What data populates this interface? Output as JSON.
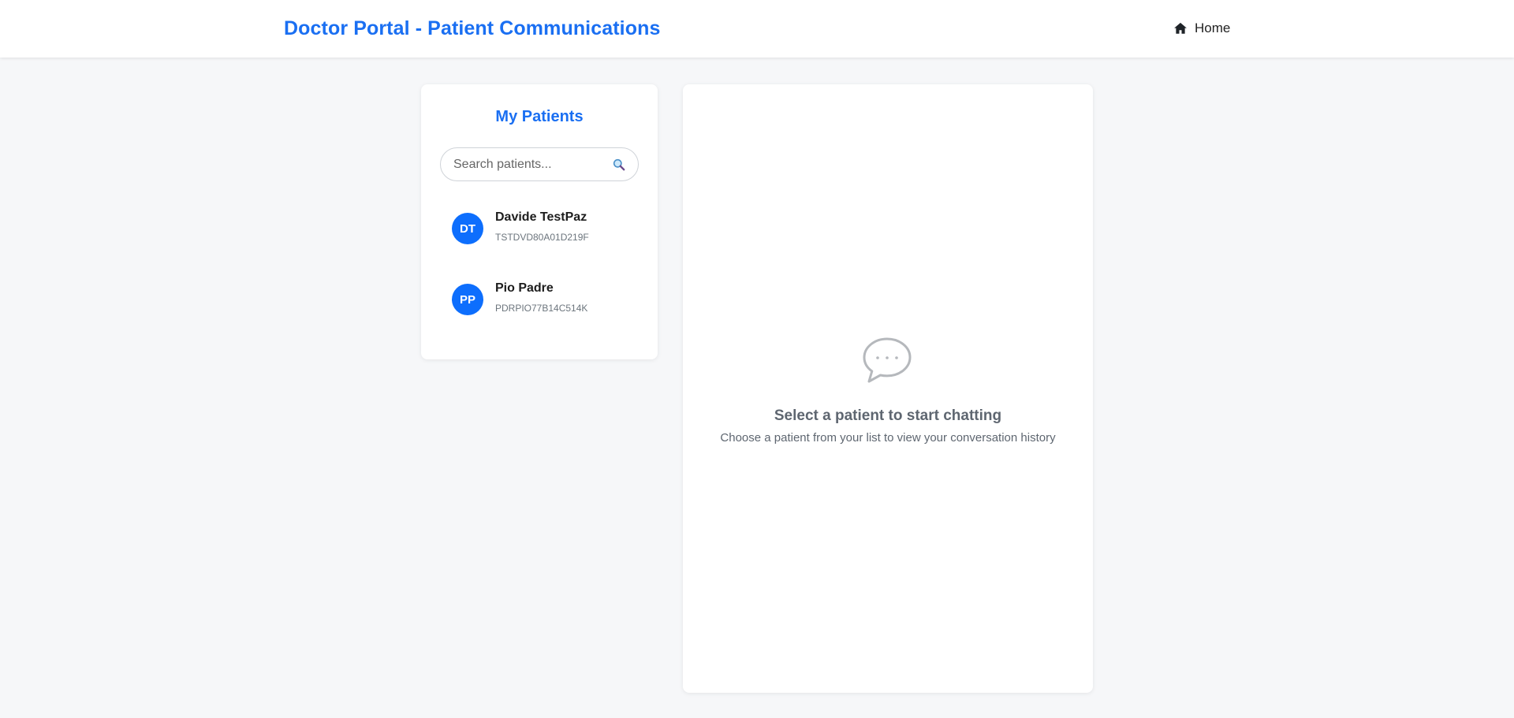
{
  "header": {
    "title": "Doctor Portal - Patient Communications",
    "home_label": "Home"
  },
  "sidebar": {
    "title": "My Patients",
    "search_placeholder": "Search patients...",
    "patients": [
      {
        "initials": "DT",
        "name": "Davide TestPaz",
        "code": "TSTDVD80A01D219F"
      },
      {
        "initials": "PP",
        "name": "Pio Padre",
        "code": "PDRPIO77B14C514K"
      }
    ]
  },
  "chat": {
    "empty_title": "Select a patient to start chatting",
    "empty_subtitle": "Choose a patient from your list to view your conversation history"
  },
  "colors": {
    "brand": "#1a6ff2",
    "avatar": "#0d6efd",
    "background": "#f6f7f9"
  },
  "icons": {
    "home": "home-icon",
    "search": "search-icon",
    "chat": "chat-bubble-icon"
  }
}
